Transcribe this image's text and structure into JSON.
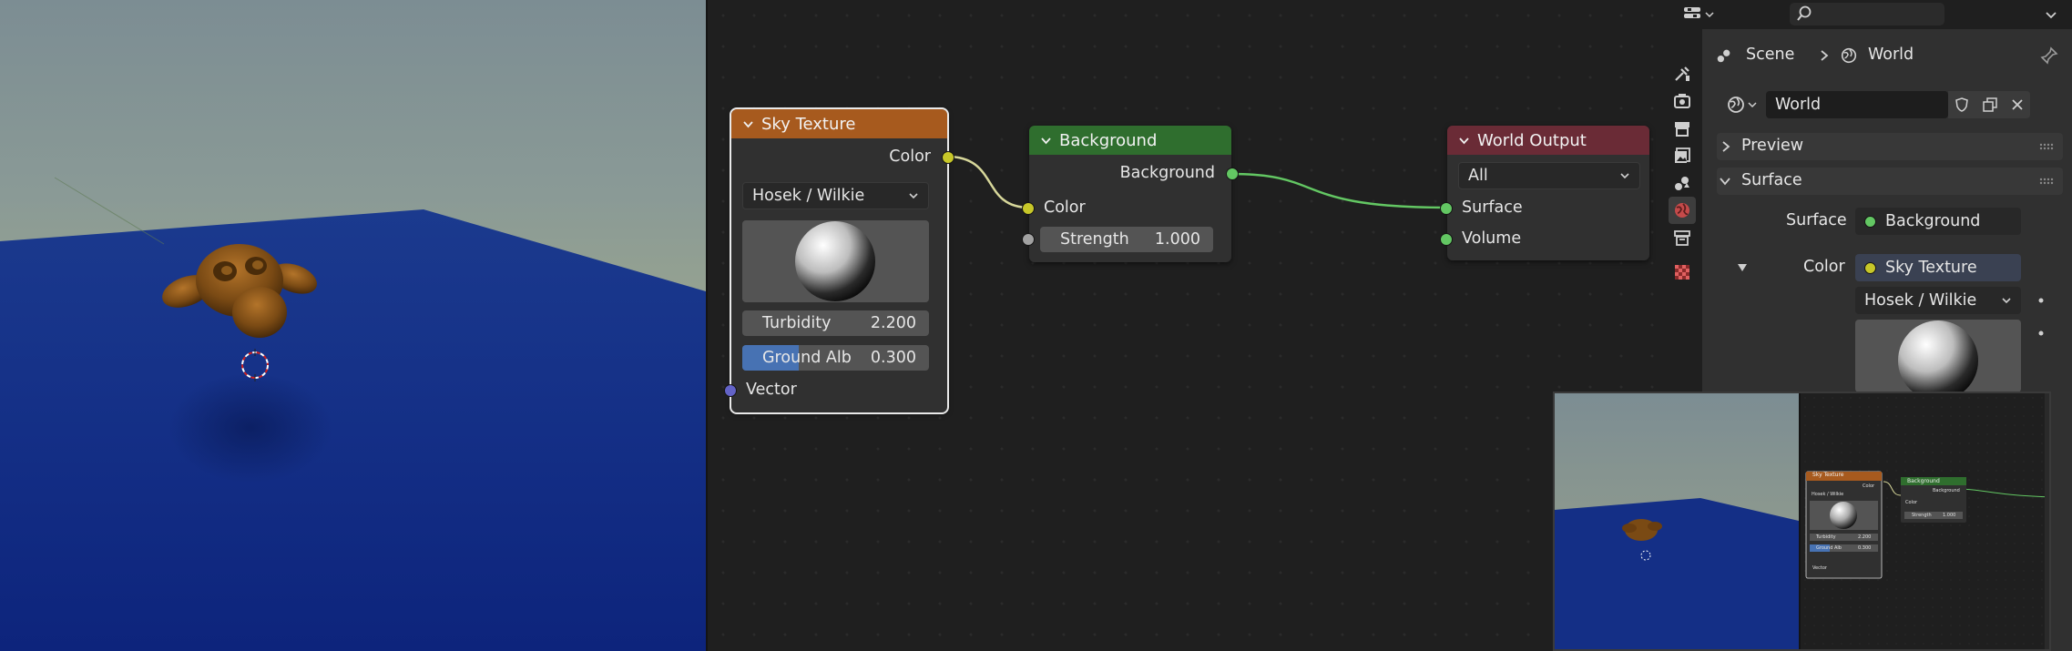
{
  "viewport": {
    "sky_color": "#8a9a96",
    "ground_color": "#102a8a",
    "object": "suzanne-monkey-head"
  },
  "node_editor": {
    "sky_texture": {
      "title": "Sky Texture",
      "output_color": "Color",
      "sky_type": "Hosek / Wilkie",
      "turbidity_label": "Turbidity",
      "turbidity_value": "2.200",
      "ground_albedo_label": "Ground Alb",
      "ground_albedo_value": "0.300",
      "ground_albedo_fraction": 0.3,
      "input_vector": "Vector",
      "header_color": "#a75a1e"
    },
    "background": {
      "title": "Background",
      "output_background": "Background",
      "input_color": "Color",
      "strength_label": "Strength",
      "strength_value": "1.000",
      "header_color": "#2f6e2e"
    },
    "world_output": {
      "title": "World Output",
      "target": "All",
      "input_surface": "Surface",
      "input_volume": "Volume",
      "header_color": "#6a2b36"
    }
  },
  "properties": {
    "breadcrumb_scene": "Scene",
    "breadcrumb_world": "World",
    "world_name": "World",
    "panel_preview": "Preview",
    "panel_surface": "Surface",
    "surface_label": "Surface",
    "surface_value": "Background",
    "color_label": "Color",
    "color_value": "Sky Texture",
    "sky_type": "Hosek / Wilkie"
  },
  "thumbnail": {
    "sky_texture_title": "Sky Texture",
    "background_title": "Background",
    "color": "Color",
    "sky_type": "Hosek / Wilkie",
    "turbidity": "Turbidity",
    "turbidity_value": "2.200",
    "ground_albedo": "Ground Alb",
    "ground_albedo_value": "0.300",
    "vector": "Vector",
    "background_output": "Background",
    "strength": "Strength",
    "strength_value": "1.000"
  }
}
